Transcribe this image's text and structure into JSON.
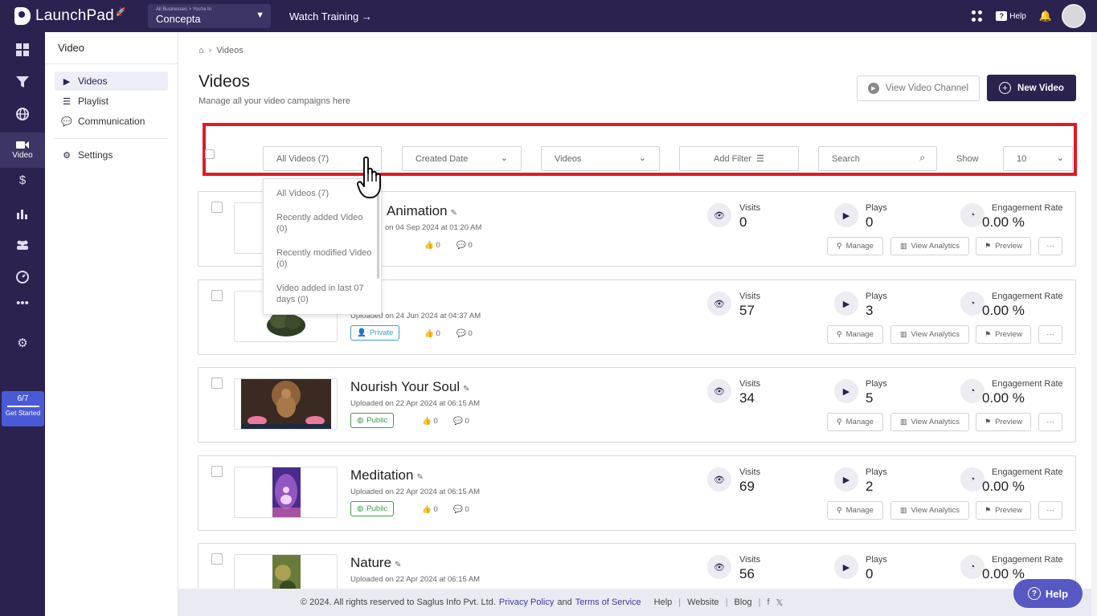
{
  "topbar": {
    "logo": "LaunchPad",
    "business_small": "All Businesses > You're In",
    "business_name": "Concepta",
    "watch_training": "Watch Training →",
    "help_label": "Help"
  },
  "rail": {
    "active_label": "Video",
    "progress": "6/7",
    "progress_fraction": 0.857,
    "get_started": "Get Started"
  },
  "sidebar": {
    "title": "Video",
    "items": [
      {
        "label": "Videos",
        "icon": "video-icon",
        "active": true
      },
      {
        "label": "Playlist",
        "icon": "playlist-icon",
        "active": false
      },
      {
        "label": "Communication",
        "icon": "communication-icon",
        "active": false
      },
      {
        "label": "Settings",
        "icon": "gear-icon",
        "active": false
      }
    ]
  },
  "breadcrumb": {
    "current": "Videos"
  },
  "page": {
    "title": "Videos",
    "subtitle": "Manage all your video campaigns here",
    "view_channel": "View Video Channel",
    "new_video": "New Video"
  },
  "filters": {
    "all_videos": "All Videos (7)",
    "created_date": "Created Date",
    "type": "Videos",
    "add_filter": "Add Filter",
    "search_placeholder": "Search",
    "show_label": "Show",
    "show_value": "10"
  },
  "dropdown": {
    "options": [
      "All Videos (7)",
      "Recently added Video (0)",
      "Recently modified Video (0)",
      "Video added in last 07 days (0)"
    ]
  },
  "stats_labels": {
    "visits": "Visits",
    "plays": "Plays",
    "engagement": "Engagement Rate"
  },
  "actions": {
    "manage": "Manage",
    "analytics": "View Analytics",
    "preview": "Preview",
    "more": "···"
  },
  "videos": [
    {
      "title": "Animation",
      "date": "on 04 Sep 2024 at 01:20 AM",
      "visibility": "ate",
      "likes": "0",
      "comments": "0",
      "visits": "0",
      "plays": "0",
      "engagement": "0.00 %"
    },
    {
      "title": "",
      "date": "Uploaded on 24 Jun 2024 at 04:37 AM",
      "visibility": "Private",
      "likes": "0",
      "comments": "0",
      "visits": "57",
      "plays": "3",
      "engagement": "0.00 %"
    },
    {
      "title": "Nourish Your Soul",
      "date": "Uploaded on 22 Apr 2024 at 06:15 AM",
      "visibility": "Public",
      "likes": "0",
      "comments": "0",
      "visits": "34",
      "plays": "5",
      "engagement": "0.00 %"
    },
    {
      "title": "Meditation",
      "date": "Uploaded on 22 Apr 2024 at 06:15 AM",
      "visibility": "Public",
      "likes": "0",
      "comments": "0",
      "visits": "69",
      "plays": "2",
      "engagement": "0.00 %"
    },
    {
      "title": "Nature",
      "date": "Uploaded on 22 Apr 2024 at 06:15 AM",
      "visibility": "",
      "likes": "",
      "comments": "",
      "visits": "56",
      "plays": "0",
      "engagement": "0.00 %"
    }
  ],
  "footer": {
    "copyright": "© 2024. All rights reserved to Saglus Info Pvt. Ltd.",
    "privacy": "Privacy Policy",
    "and": "and",
    "terms": "Terms of Service",
    "help": "Help",
    "website": "Website",
    "blog": "Blog",
    "sep": "|"
  },
  "help_button": "Help",
  "colors": {
    "brand": "#2b2250",
    "highlight": "#e01b24",
    "help_button": "#5858c4",
    "public": "#3aa142",
    "private": "#3ba0c9"
  }
}
